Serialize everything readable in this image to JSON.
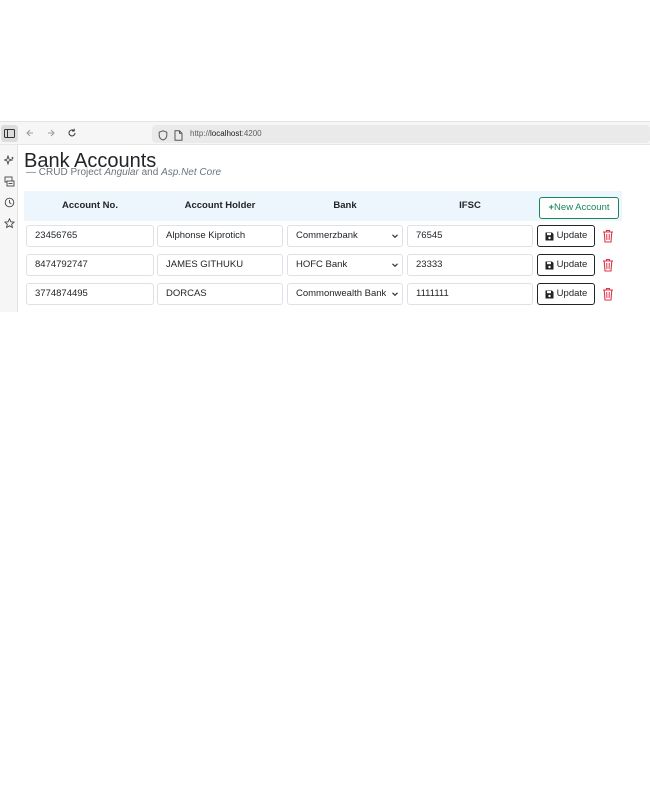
{
  "browser": {
    "url_prefix": "http://",
    "url_host": "localhost",
    "url_port": ":4200"
  },
  "page": {
    "title": "Bank Accounts",
    "subtitle_dash": "—",
    "subtitle_plain": "CRUD Project",
    "subtitle_italic1": "Angular",
    "subtitle_and": "and",
    "subtitle_italic2": "Asp.Net Core"
  },
  "table": {
    "headers": [
      "Account No.",
      "Account Holder",
      "Bank",
      "IFSC"
    ],
    "new_button_label": "New Account",
    "rows": [
      {
        "account_no": "23456765",
        "holder": "Alphonse Kiprotich",
        "bank": "Commerzbank",
        "ifsc": "76545"
      },
      {
        "account_no": "8474792747",
        "holder": "JAMES GITHUKU",
        "bank": "HOFC Bank",
        "ifsc": "23333"
      },
      {
        "account_no": "3774874495",
        "holder": "DORCAS",
        "bank": "Commonwealth Bank",
        "ifsc": "1111111"
      }
    ],
    "update_label": "Update"
  },
  "icons": {
    "sidebar_toggle": "sidebar-icon",
    "back": "arrow-left-icon",
    "forward": "arrow-right-icon",
    "reload": "reload-icon",
    "shield": "shield-icon",
    "page": "page-icon",
    "ai": "sparkle-icon",
    "tabs": "synced-tabs-icon",
    "history": "history-icon",
    "bookmarks": "star-icon",
    "save": "floppy-disk-icon",
    "delete": "trash-icon"
  },
  "colors": {
    "success": "#198754",
    "danger": "#dc3545",
    "header_bg": "#eef6fd"
  }
}
